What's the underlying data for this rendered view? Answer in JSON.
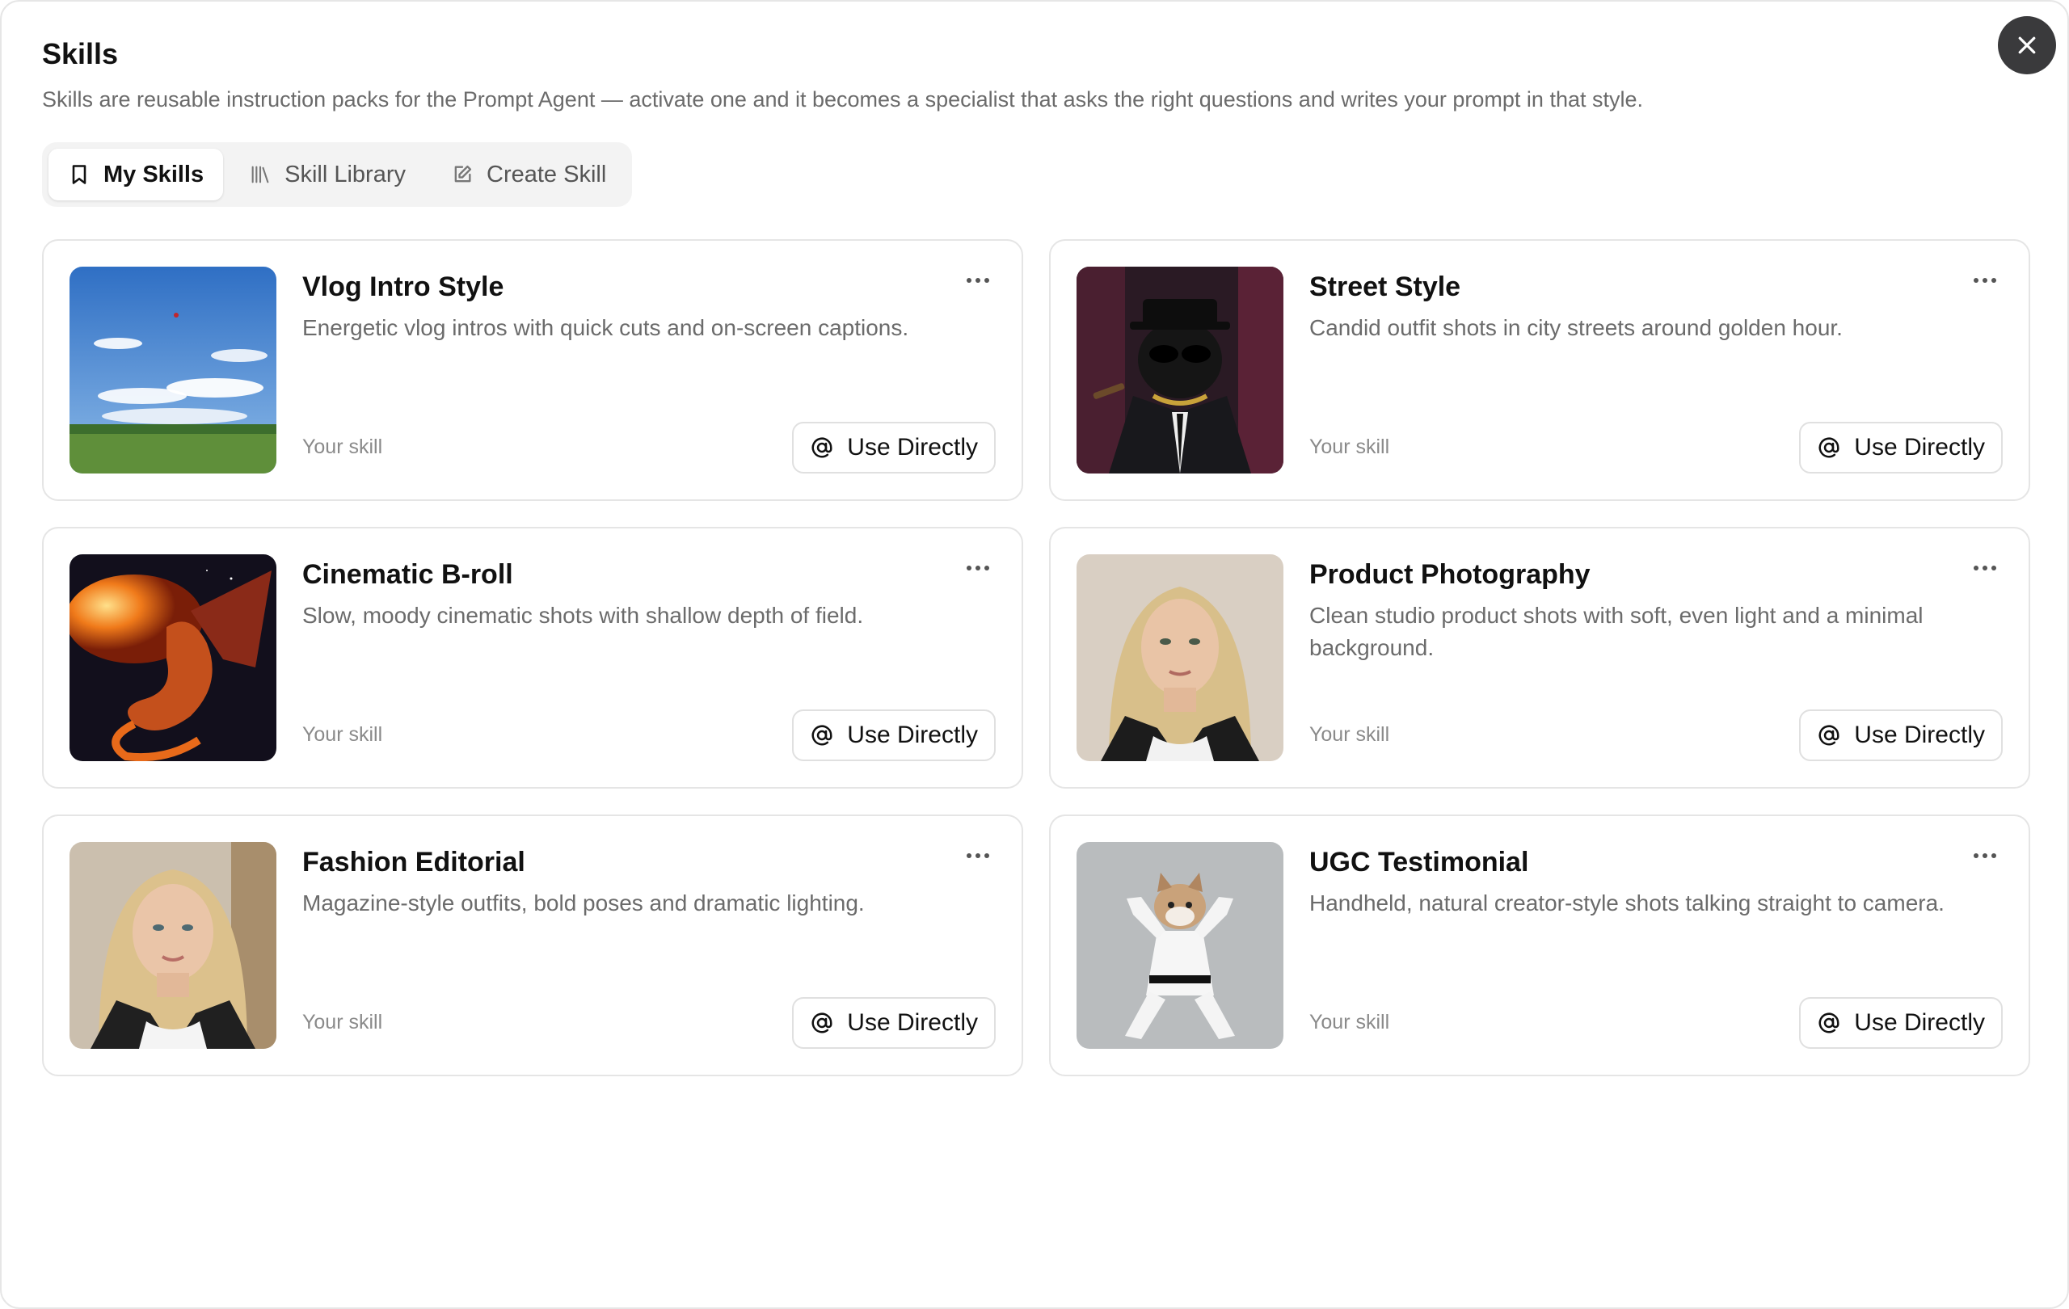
{
  "modal": {
    "title": "Skills",
    "subtitle": "Skills are reusable instruction packs for the Prompt Agent — activate one and it becomes a specialist that asks the right questions and writes your prompt in that style."
  },
  "tabs": [
    {
      "label": "My Skills",
      "icon": "bookmark-icon",
      "active": true
    },
    {
      "label": "Skill Library",
      "icon": "library-icon",
      "active": false
    },
    {
      "label": "Create Skill",
      "icon": "edit-icon",
      "active": false
    }
  ],
  "skills": [
    {
      "title": "Vlog Intro Style",
      "description": "Energetic vlog intros with quick cuts and on-screen captions.",
      "owner": "Your skill",
      "action": "Use Directly"
    },
    {
      "title": "Street Style",
      "description": "Candid outfit shots in city streets around golden hour.",
      "owner": "Your skill",
      "action": "Use Directly"
    },
    {
      "title": "Cinematic B-roll",
      "description": "Slow, moody cinematic shots with shallow depth of field.",
      "owner": "Your skill",
      "action": "Use Directly"
    },
    {
      "title": "Product Photography",
      "description": "Clean studio product shots with soft, even light and a minimal background.",
      "owner": "Your skill",
      "action": "Use Directly"
    },
    {
      "title": "Fashion Editorial",
      "description": "Magazine-style outfits, bold poses and dramatic lighting.",
      "owner": "Your skill",
      "action": "Use Directly"
    },
    {
      "title": "UGC Testimonial",
      "description": "Handheld, natural creator-style shots talking straight to camera.",
      "owner": "Your skill",
      "action": "Use Directly"
    }
  ],
  "icons": {
    "close": "close-icon",
    "more": "more-horizontal-icon",
    "at": "at-sign-icon"
  },
  "colors": {
    "close_button_bg": "#3a3a3c",
    "muted_text": "#6b6b6b",
    "border": "#e5e5e5",
    "tab_bar_bg": "#f3f3f3"
  }
}
